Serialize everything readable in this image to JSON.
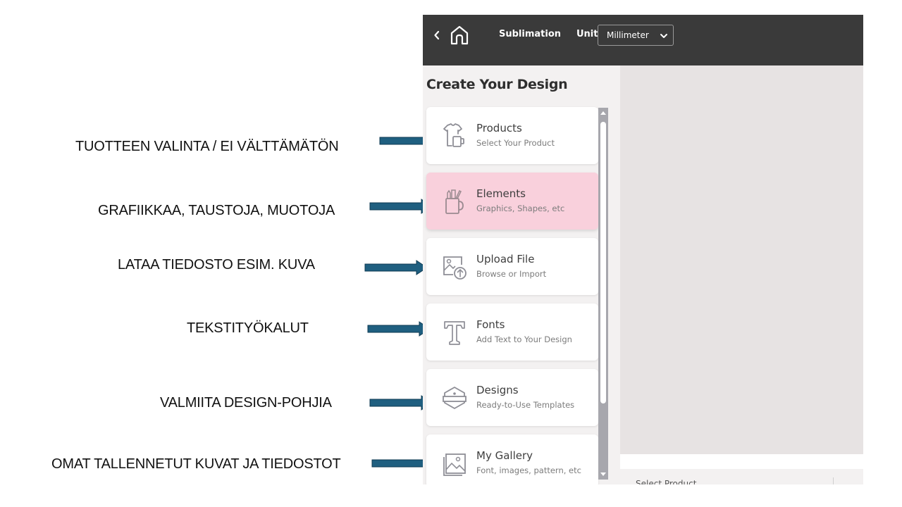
{
  "annotations": [
    {
      "label": "TUOTTEEN VALINTA / EI VÄLTTÄMÄTÖN",
      "target": "Products"
    },
    {
      "label": "GRAFIIKKAA, TAUSTOJA, MUOTOJA",
      "target": "Elements"
    },
    {
      "label": "LATAA TIEDOSTO ESIM. KUVA",
      "target": "Upload File"
    },
    {
      "label": "TEKSTITYÖKALUT",
      "target": "Fonts"
    },
    {
      "label": "VALMIITA DESIGN-POHJIA",
      "target": "Designs"
    },
    {
      "label": "OMAT TALLENNETUT KUVAT JA TIEDOSTOT",
      "target": "My Gallery"
    }
  ],
  "colors": {
    "arrow": "#1f5f80",
    "topbar": "#3a3a3a",
    "active_card": "#f9d0dc",
    "canvas": "#e7e3e3"
  },
  "topbar": {
    "back_icon": "chevron-left-icon",
    "home_icon": "home-icon",
    "mode": "Sublimation",
    "unit_label": "Unit",
    "unit_value": "Millimeter"
  },
  "panel": {
    "title": "Create Your Design",
    "items": [
      {
        "title": "Products",
        "subtitle": "Select Your Product",
        "icon": "tshirt-mug-icon",
        "active": false
      },
      {
        "title": "Elements",
        "subtitle": "Graphics, Shapes, etc",
        "icon": "pencil-cup-icon",
        "active": true
      },
      {
        "title": "Upload File",
        "subtitle": "Browse or Import",
        "icon": "image-upload-icon",
        "active": false
      },
      {
        "title": "Fonts",
        "subtitle": "Add Text to Your Design",
        "icon": "text-t-icon",
        "active": false
      },
      {
        "title": "Designs",
        "subtitle": "Ready-to-Use Templates",
        "icon": "badge-template-icon",
        "active": false
      },
      {
        "title": "My Gallery",
        "subtitle": "Font, images, pattern, etc",
        "icon": "gallery-image-icon",
        "active": false
      }
    ]
  },
  "bottom_bar": {
    "select_product": "Select Product"
  }
}
